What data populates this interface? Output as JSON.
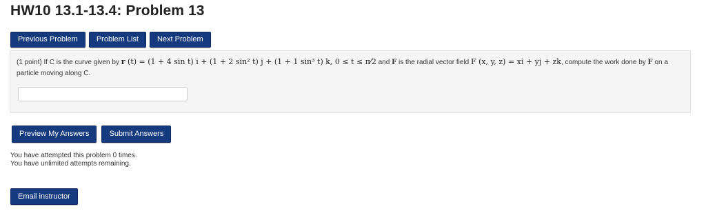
{
  "page": {
    "title": "HW10 13.1-13.4: Problem 13"
  },
  "nav": {
    "previous": "Previous Problem",
    "list": "Problem List",
    "next": "Next Problem"
  },
  "problem": {
    "intro": "(1 point) If C is the curve given by ",
    "r_vec": "r",
    "r_expr": " (t) = (1 + 4 sin t) i + (1 + 2 sin² t) j + (1 + 1 sin³ t) k, 0 ≤ t ≤ π⁄2",
    "mid": " and ",
    "f_bold": "F",
    "mid2": " is the radial vector field ",
    "F_expr": "F (x, y, z) = xi + yj + zk",
    "mid3": ", compute the work done by ",
    "f_bold2": "F",
    "end": " on a particle moving along C.",
    "answer_value": ""
  },
  "actions": {
    "preview": "Preview My Answers",
    "submit": "Submit Answers"
  },
  "status": {
    "attempts": "You have attempted this problem 0 times.",
    "remaining": "You have unlimited attempts remaining."
  },
  "email": {
    "label": "Email instructor"
  },
  "colors": {
    "button_bg": "#163a7e",
    "panel_bg": "#f5f5f5"
  }
}
